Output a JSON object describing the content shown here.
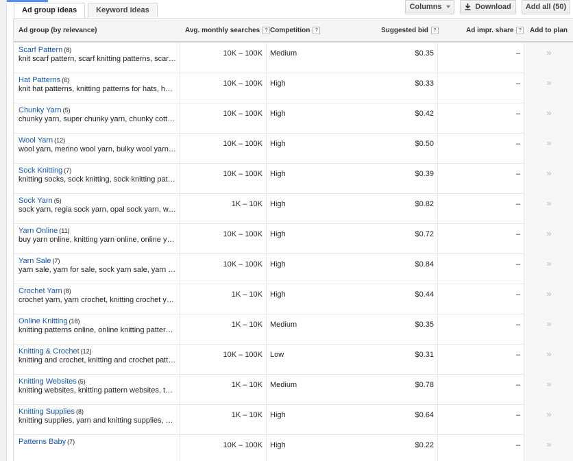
{
  "tabs": [
    {
      "label": "Ad group ideas",
      "active": true
    },
    {
      "label": "Keyword ideas",
      "active": false
    }
  ],
  "toolbar": {
    "columns_label": "Columns",
    "download_label": "Download",
    "add_all_label": "Add all (50)"
  },
  "table": {
    "headers": {
      "group": "Ad group (by relevance)",
      "searches": "Avg. monthly searches",
      "competition": "Competition",
      "bid": "Suggested bid",
      "share": "Ad impr. share",
      "add": "Add to plan"
    },
    "help_glyph": "?",
    "add_glyph": "»",
    "rows": [
      {
        "name": "Scarf Pattern",
        "count": "(8)",
        "keywords": "knit scarf pattern, scarf knitting patterns, scarf pattern, scarf patterns, knitted scarf",
        "searches": "10K – 100K",
        "competition": "Medium",
        "bid": "$0.35",
        "share": "–"
      },
      {
        "name": "Hat Patterns",
        "count": "(6)",
        "keywords": "knit hat patterns, knitting patterns for hats, hat patterns, free hat patterns",
        "searches": "10K – 100K",
        "competition": "High",
        "bid": "$0.33",
        "share": "–"
      },
      {
        "name": "Chunky Yarn",
        "count": "(5)",
        "keywords": "chunky yarn, super chunky yarn, chunky cotton yarn, chunky wool yarn",
        "searches": "10K – 100K",
        "competition": "High",
        "bid": "$0.42",
        "share": "–"
      },
      {
        "name": "Wool Yarn",
        "count": "(12)",
        "keywords": "wool yarn, merino wool yarn, bulky wool yarn, wool yarn online",
        "searches": "10K – 100K",
        "competition": "High",
        "bid": "$0.50",
        "share": "–"
      },
      {
        "name": "Sock Knitting",
        "count": "(7)",
        "keywords": "knitting socks, sock knitting, sock knitting patterns, knit socks",
        "searches": "10K – 100K",
        "competition": "High",
        "bid": "$0.39",
        "share": "–"
      },
      {
        "name": "Sock Yarn",
        "count": "(5)",
        "keywords": "sock yarn, regia sock yarn, opal sock yarn, wool sock yarn",
        "searches": "1K – 10K",
        "competition": "High",
        "bid": "$0.82",
        "share": "–"
      },
      {
        "name": "Yarn Online",
        "count": "(11)",
        "keywords": "buy yarn online, knitting yarn online, online yarn store, yarn shop",
        "searches": "10K – 100K",
        "competition": "High",
        "bid": "$0.72",
        "share": "–"
      },
      {
        "name": "Yarn Sale",
        "count": "(7)",
        "keywords": "yarn sale, yarn for sale, sock yarn sale, yarn clearance sale",
        "searches": "10K – 100K",
        "competition": "High",
        "bid": "$0.84",
        "share": "–"
      },
      {
        "name": "Crochet Yarn",
        "count": "(8)",
        "keywords": "crochet yarn, yarn crochet, knitting crochet yarn, cotton crochet",
        "searches": "1K – 10K",
        "competition": "High",
        "bid": "$0.44",
        "share": "–"
      },
      {
        "name": "Online Knitting",
        "count": "(18)",
        "keywords": "knitting patterns online, online knitting patterns, knitting online",
        "searches": "1K – 10K",
        "competition": "Medium",
        "bid": "$0.35",
        "share": "–"
      },
      {
        "name": "Knitting & Crochet",
        "count": "(12)",
        "keywords": "knitting and crochet, knitting and crochet patterns, crochet knitting",
        "searches": "10K – 100K",
        "competition": "Low",
        "bid": "$0.31",
        "share": "–"
      },
      {
        "name": "Knitting Websites",
        "count": "(5)",
        "keywords": "knitting websites, knitting pattern websites, top knitting websites",
        "searches": "1K – 10K",
        "competition": "Medium",
        "bid": "$0.78",
        "share": "–"
      },
      {
        "name": "Knitting Supplies",
        "count": "(8)",
        "keywords": "knitting supplies, yarn and knitting supplies, knitting supply store",
        "searches": "1K – 10K",
        "competition": "High",
        "bid": "$0.64",
        "share": "–"
      },
      {
        "name": "Patterns Baby",
        "count": "(7)",
        "keywords": "",
        "searches": "10K – 100K",
        "competition": "High",
        "bid": "$0.22",
        "share": "–"
      }
    ]
  },
  "colors": {
    "link": "#1155cc",
    "accent": "#4d90fe",
    "header_bg": "#f5f5f5"
  },
  "icons": {
    "columns": "chevron-down-icon",
    "download": "download-icon",
    "help": "help-icon",
    "add": "double-chevron-right-icon"
  }
}
